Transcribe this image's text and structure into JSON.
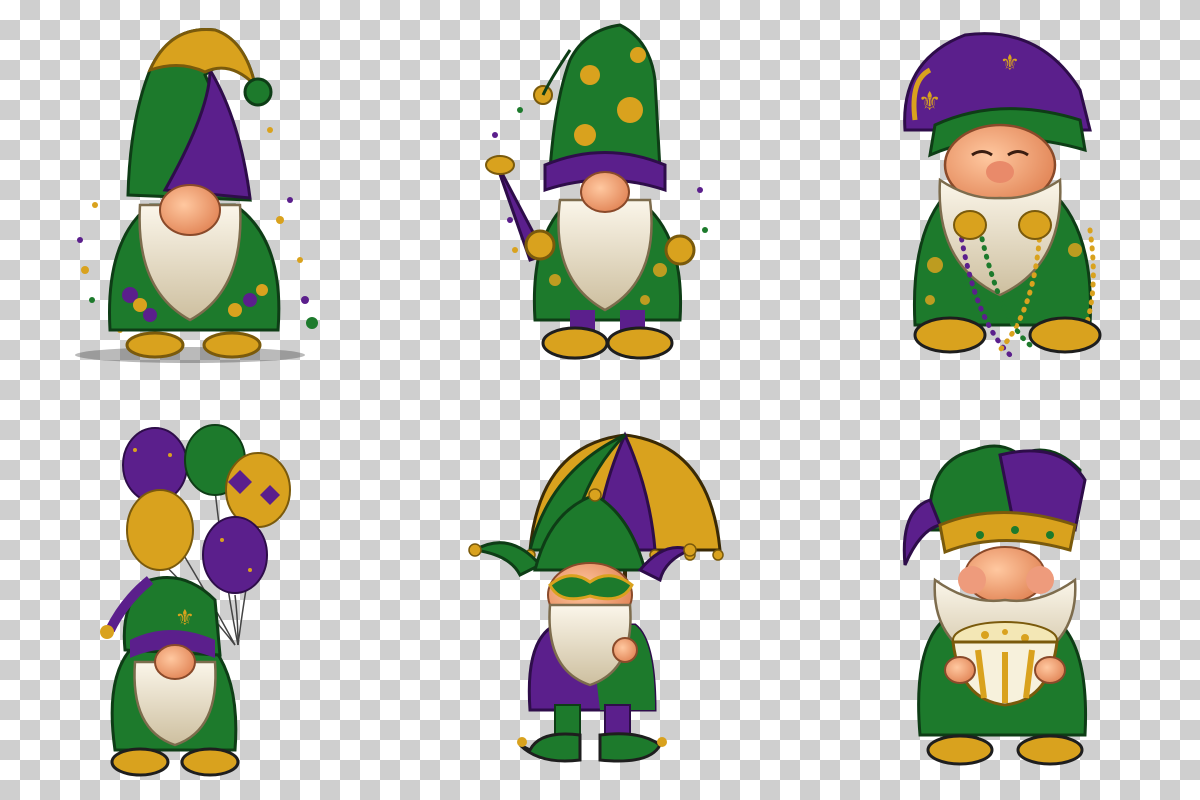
{
  "canvas": {
    "background": "transparency-checkerboard"
  },
  "palette": {
    "purple": "#5b1f8c",
    "green": "#1d7a2c",
    "gold": "#d9a21e",
    "skin": "#f0a47a",
    "beard": "#efe6d2"
  },
  "gnomes": [
    {
      "icon": "gnome-with-beads-icon"
    },
    {
      "icon": "gnome-with-horn-icon"
    },
    {
      "icon": "smiling-gnome-with-beads-icon"
    },
    {
      "icon": "gnome-with-balloons-icon"
    },
    {
      "icon": "jester-gnome-with-umbrella-icon"
    },
    {
      "icon": "gnome-with-popcorn-bowl-icon"
    }
  ]
}
